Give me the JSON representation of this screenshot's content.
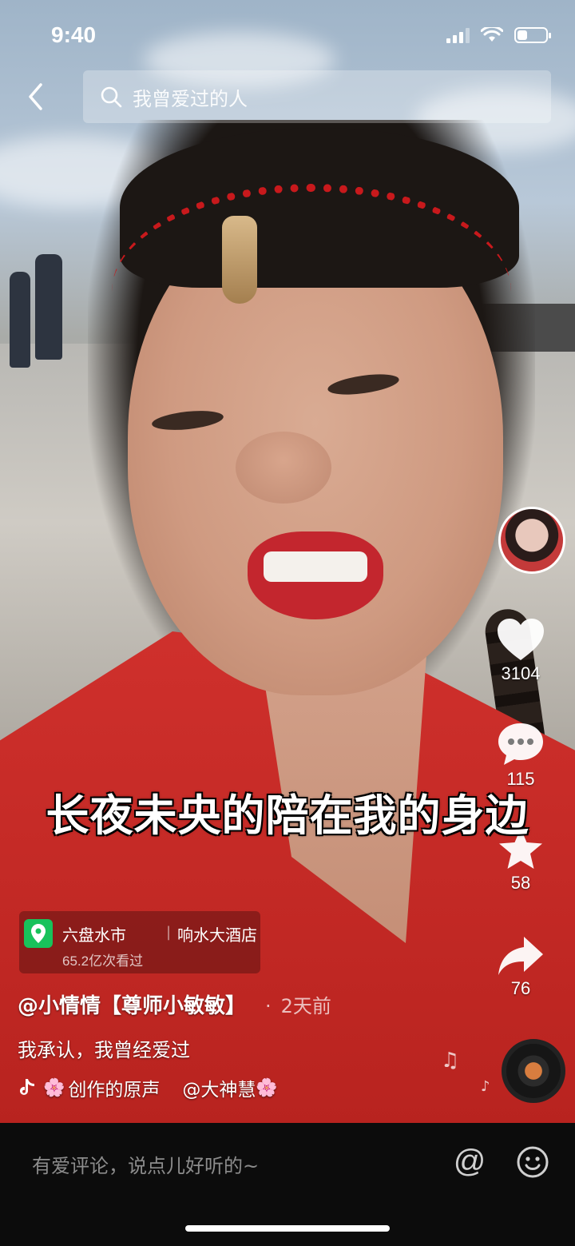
{
  "status_bar": {
    "time": "9:40",
    "battery_level": 0.35
  },
  "search": {
    "query": "我曾爱过的人"
  },
  "icons": {
    "back": "chevron-left-icon",
    "search": "search-icon",
    "like": "heart-icon",
    "comment": "comment-icon",
    "favorite": "star-icon",
    "share": "share-icon",
    "location": "location-pin-icon",
    "at": "at-icon",
    "emoji": "smiley-icon",
    "music": "music-note-icon"
  },
  "actions": {
    "likes": "3104",
    "comments": "115",
    "favorites": "58",
    "shares": "76"
  },
  "subtitle": "长夜未央的陪在我的身边",
  "location": {
    "city": "六盘水市",
    "place": "响水大酒店",
    "views": "65.2亿次看过"
  },
  "post": {
    "author": "@小情情【尊师小敏敏】",
    "time": "2天前",
    "caption": "我承认，我曾经爱过",
    "music_title": "创作的原声",
    "music_mention": "@大神慧",
    "flower": "🌸"
  },
  "comment_bar": {
    "placeholder": "有爱评论，说点儿好听的~"
  },
  "colors": {
    "location_green": "#18c25b",
    "shirt_red": "#c8191c"
  }
}
